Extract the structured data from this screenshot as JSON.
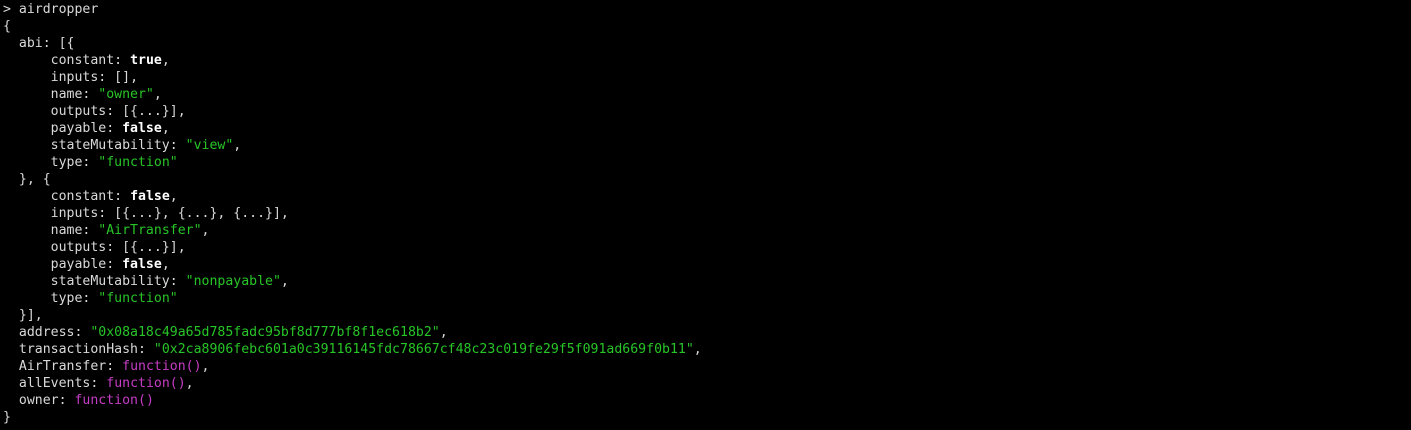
{
  "prompt": {
    "symbol": ">",
    "command": "airdropper"
  },
  "output": {
    "open_brace": "{",
    "abi_label": "abi",
    "abi_open": "[{",
    "entry_sep": "}, {",
    "abi_close": "}],",
    "close_brace": "}",
    "abi": [
      {
        "constant": "true",
        "inputs": "[]",
        "name": "\"owner\"",
        "outputs": "[{...}]",
        "payable": "false",
        "stateMutability": "\"view\"",
        "type": "\"function\""
      },
      {
        "constant": "false",
        "inputs": "[{...}, {...}, {...}]",
        "name": "\"AirTransfer\"",
        "outputs": "[{...}]",
        "payable": "false",
        "stateMutability": "\"nonpayable\"",
        "type": "\"function\""
      }
    ],
    "address_label": "address",
    "address": "\"0x08a18c49a65d785fadc95bf8d777bf8f1ec618b2\"",
    "transactionHash_label": "transactionHash",
    "transactionHash": "\"0x2ca8906febc601a0c39116145fdc78667cf48c23c019fe29f5f091ad669f0b11\"",
    "AirTransfer_label": "AirTransfer",
    "AirTransfer": "function()",
    "allEvents_label": "allEvents",
    "allEvents": "function()",
    "owner_label": "owner",
    "owner": "function()"
  },
  "keys": {
    "constant": "constant",
    "inputs": "inputs",
    "name": "name",
    "outputs": "outputs",
    "payable": "payable",
    "stateMutability": "stateMutability",
    "type": "type"
  },
  "colors": {
    "background": "#000000",
    "text": "#d9d9d9",
    "string": "#28c528",
    "function": "#c53dc5",
    "boolean": "#ffffff"
  }
}
